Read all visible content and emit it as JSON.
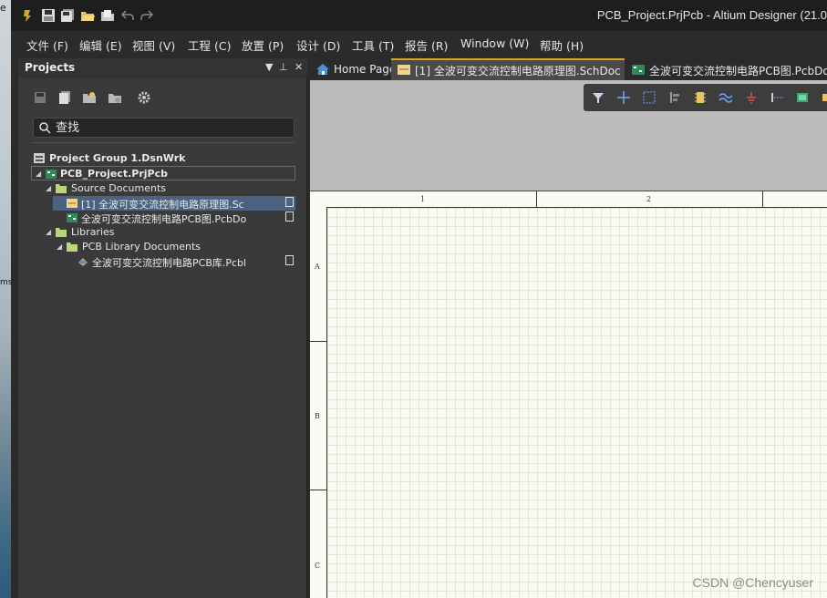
{
  "window": {
    "title": "PCB_Project.PrjPcb - Altium Designer (21.0"
  },
  "desktop": {
    "glyph_top": "e",
    "glyph_mid": "ms"
  },
  "menu": {
    "items": [
      "文件 (F)",
      "编辑 (E)",
      "视图 (V)",
      "工程 (C)",
      "放置 (P)",
      "设计 (D)",
      "工具 (T)",
      "报告 (R)",
      "Window (W)",
      "帮助 (H)"
    ]
  },
  "panel": {
    "title": "Projects",
    "search_placeholder": "查找",
    "tree": {
      "group": "Project Group 1.DsnWrk",
      "project": "PCB_Project.PrjPcb",
      "source_folder": "Source Documents",
      "sch_doc": "[1] 全波可变交流控制电路原理图.Sc",
      "pcb_doc": "全波可变交流控制电路PCB图.PcbDo",
      "libraries": "Libraries",
      "pcblib_folder": "PCB Library Documents",
      "pcblib_doc": "全波可变交流控制电路PCB库.Pcbl"
    }
  },
  "tabs": [
    {
      "label": "Home Page",
      "icon": "home-icon"
    },
    {
      "label": "[1] 全波可变交流控制电路原理图.SchDoc",
      "icon": "schematic-doc-icon"
    },
    {
      "label": "全波可变交流控制电路PCB图.PcbDo",
      "icon": "pcb-doc-icon"
    }
  ],
  "sheet": {
    "col_labels": [
      "1",
      "2"
    ],
    "row_labels": [
      "A",
      "B",
      "C"
    ]
  },
  "watermark": "CSDN @Chencyuser",
  "colors": {
    "accent": "#d7a520",
    "selection": "#4b6280",
    "sheet": "#fbfbf3"
  }
}
